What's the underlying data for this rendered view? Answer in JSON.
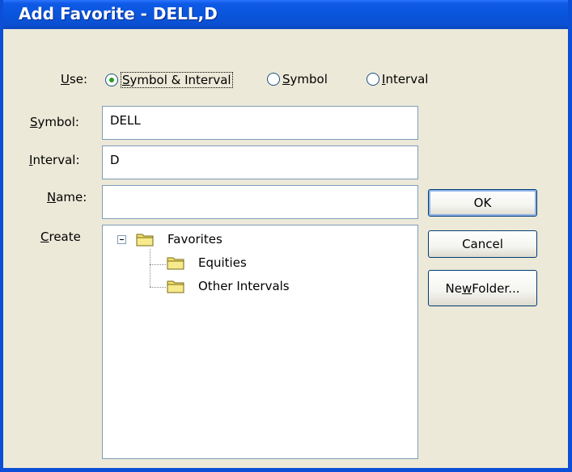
{
  "window": {
    "title": "Add Favorite - DELL,D"
  },
  "use": {
    "label_hot": "U",
    "label_rest": "se:",
    "options": [
      {
        "hot": "S",
        "rest": "ymbol & Interval",
        "selected": true
      },
      {
        "hot": "S",
        "rest": "ymbol",
        "selected": false
      },
      {
        "hot": "I",
        "rest": "nterval",
        "selected": false
      }
    ]
  },
  "fields": {
    "symbol": {
      "label_hot": "S",
      "label_rest": "ymbol:",
      "value": "DELL"
    },
    "interval": {
      "label_hot": "I",
      "label_rest": "nterval:",
      "value": "D"
    },
    "name": {
      "label_hot": "N",
      "label_rest": "ame:",
      "value": ""
    }
  },
  "create": {
    "label_hot": "C",
    "label_rest": "reate"
  },
  "tree": {
    "root": "Favorites",
    "children": [
      "Equities",
      "Other Intervals"
    ]
  },
  "buttons": {
    "ok": "OK",
    "cancel": "Cancel",
    "new_folder_pre": "Ne",
    "new_folder_hot": "w",
    "new_folder_post": " Folder..."
  },
  "colors": {
    "titlebar": "#0a55dc",
    "dialog_bg": "#ece9d8",
    "folder": "#f2e06a",
    "radio_dot": "#21a121"
  },
  "icons": {
    "folder": "folder-icon",
    "collapse": "collapse-icon"
  }
}
